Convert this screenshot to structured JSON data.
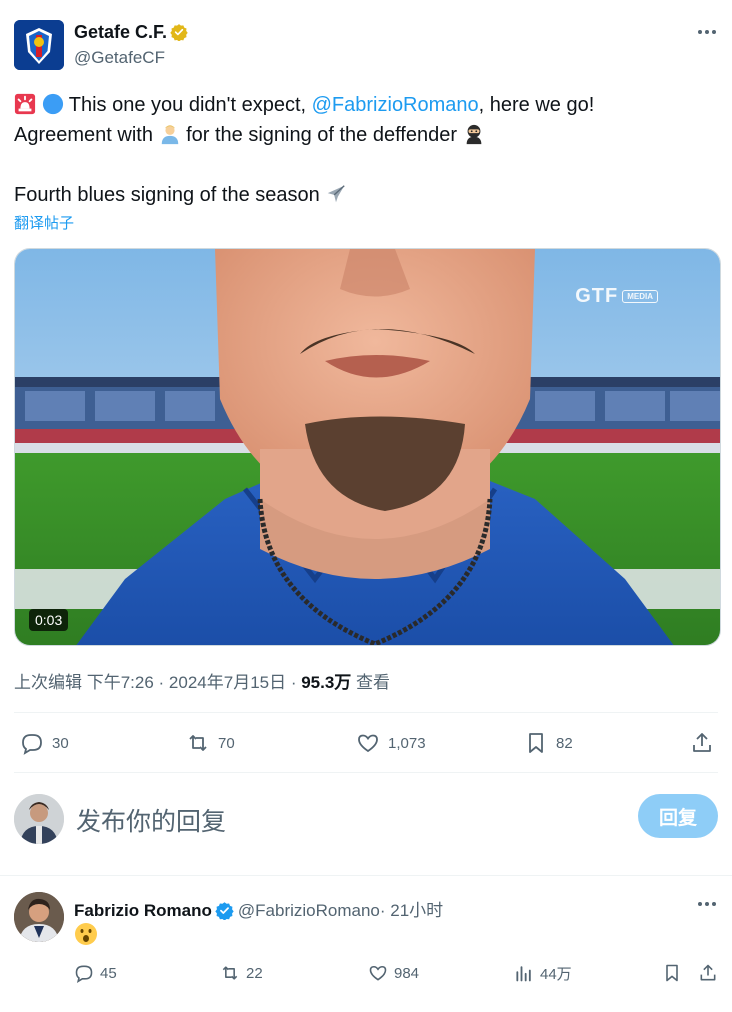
{
  "tweet": {
    "author_name": "Getafe C.F.",
    "author_handle": "@GetafeCF",
    "text_line1_before": "This one you didn't expect, ",
    "text_line1_mention": "@FabrizioRomano",
    "text_line1_after": ", here we go!",
    "text_line2_before": "Agreement with ",
    "text_line2_middle": " for the signing of the deffender ",
    "text_line3": "Fourth blues signing of the season ",
    "translate_label": "翻译帖子",
    "media_duration": "0:03",
    "media_logo_text": "GTF",
    "media_logo_tag": "MEDIA",
    "meta_prefix": "上次编辑 下午7:26 · 2024年7月15日 · ",
    "meta_views": "95.3万",
    "meta_views_suffix": " 查看"
  },
  "actions": {
    "replies": "30",
    "retweets": "70",
    "likes": "1,073",
    "bookmarks": "82"
  },
  "compose": {
    "placeholder": "发布你的回复",
    "button_label": "回复"
  },
  "reply": {
    "author_name": "Fabrizio Romano",
    "author_handle": "@FabrizioRomano",
    "time": "· 21小时",
    "replies": "45",
    "retweets": "22",
    "likes": "984",
    "views": "44万"
  },
  "colors": {
    "accent": "#1d9bf0",
    "muted": "#536471",
    "gold_badge": "#e2b719",
    "reply_button": "#8ecdf7"
  },
  "icons": [
    "more-icon",
    "verified-gold-icon",
    "siren-emoji",
    "blue-circle-emoji",
    "person-emoji",
    "ninja-emoji",
    "airplane-emoji",
    "reply-icon",
    "retweet-icon",
    "like-icon",
    "bookmark-icon",
    "share-icon",
    "views-icon",
    "verified-blue-icon",
    "surprised-emoji"
  ]
}
